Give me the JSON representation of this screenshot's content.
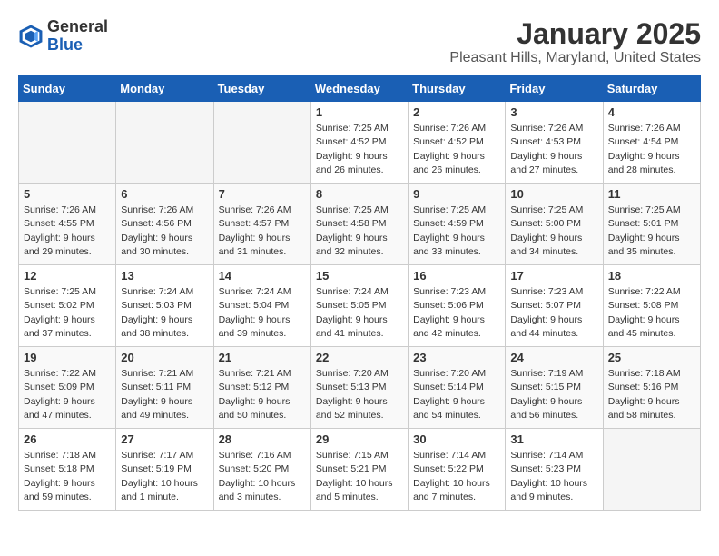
{
  "logo": {
    "general": "General",
    "blue": "Blue"
  },
  "header": {
    "month": "January 2025",
    "location": "Pleasant Hills, Maryland, United States"
  },
  "weekdays": [
    "Sunday",
    "Monday",
    "Tuesday",
    "Wednesday",
    "Thursday",
    "Friday",
    "Saturday"
  ],
  "weeks": [
    [
      {
        "day": "",
        "info": ""
      },
      {
        "day": "",
        "info": ""
      },
      {
        "day": "",
        "info": ""
      },
      {
        "day": "1",
        "info": "Sunrise: 7:25 AM\nSunset: 4:52 PM\nDaylight: 9 hours and 26 minutes."
      },
      {
        "day": "2",
        "info": "Sunrise: 7:26 AM\nSunset: 4:52 PM\nDaylight: 9 hours and 26 minutes."
      },
      {
        "day": "3",
        "info": "Sunrise: 7:26 AM\nSunset: 4:53 PM\nDaylight: 9 hours and 27 minutes."
      },
      {
        "day": "4",
        "info": "Sunrise: 7:26 AM\nSunset: 4:54 PM\nDaylight: 9 hours and 28 minutes."
      }
    ],
    [
      {
        "day": "5",
        "info": "Sunrise: 7:26 AM\nSunset: 4:55 PM\nDaylight: 9 hours and 29 minutes."
      },
      {
        "day": "6",
        "info": "Sunrise: 7:26 AM\nSunset: 4:56 PM\nDaylight: 9 hours and 30 minutes."
      },
      {
        "day": "7",
        "info": "Sunrise: 7:26 AM\nSunset: 4:57 PM\nDaylight: 9 hours and 31 minutes."
      },
      {
        "day": "8",
        "info": "Sunrise: 7:25 AM\nSunset: 4:58 PM\nDaylight: 9 hours and 32 minutes."
      },
      {
        "day": "9",
        "info": "Sunrise: 7:25 AM\nSunset: 4:59 PM\nDaylight: 9 hours and 33 minutes."
      },
      {
        "day": "10",
        "info": "Sunrise: 7:25 AM\nSunset: 5:00 PM\nDaylight: 9 hours and 34 minutes."
      },
      {
        "day": "11",
        "info": "Sunrise: 7:25 AM\nSunset: 5:01 PM\nDaylight: 9 hours and 35 minutes."
      }
    ],
    [
      {
        "day": "12",
        "info": "Sunrise: 7:25 AM\nSunset: 5:02 PM\nDaylight: 9 hours and 37 minutes."
      },
      {
        "day": "13",
        "info": "Sunrise: 7:24 AM\nSunset: 5:03 PM\nDaylight: 9 hours and 38 minutes."
      },
      {
        "day": "14",
        "info": "Sunrise: 7:24 AM\nSunset: 5:04 PM\nDaylight: 9 hours and 39 minutes."
      },
      {
        "day": "15",
        "info": "Sunrise: 7:24 AM\nSunset: 5:05 PM\nDaylight: 9 hours and 41 minutes."
      },
      {
        "day": "16",
        "info": "Sunrise: 7:23 AM\nSunset: 5:06 PM\nDaylight: 9 hours and 42 minutes."
      },
      {
        "day": "17",
        "info": "Sunrise: 7:23 AM\nSunset: 5:07 PM\nDaylight: 9 hours and 44 minutes."
      },
      {
        "day": "18",
        "info": "Sunrise: 7:22 AM\nSunset: 5:08 PM\nDaylight: 9 hours and 45 minutes."
      }
    ],
    [
      {
        "day": "19",
        "info": "Sunrise: 7:22 AM\nSunset: 5:09 PM\nDaylight: 9 hours and 47 minutes."
      },
      {
        "day": "20",
        "info": "Sunrise: 7:21 AM\nSunset: 5:11 PM\nDaylight: 9 hours and 49 minutes."
      },
      {
        "day": "21",
        "info": "Sunrise: 7:21 AM\nSunset: 5:12 PM\nDaylight: 9 hours and 50 minutes."
      },
      {
        "day": "22",
        "info": "Sunrise: 7:20 AM\nSunset: 5:13 PM\nDaylight: 9 hours and 52 minutes."
      },
      {
        "day": "23",
        "info": "Sunrise: 7:20 AM\nSunset: 5:14 PM\nDaylight: 9 hours and 54 minutes."
      },
      {
        "day": "24",
        "info": "Sunrise: 7:19 AM\nSunset: 5:15 PM\nDaylight: 9 hours and 56 minutes."
      },
      {
        "day": "25",
        "info": "Sunrise: 7:18 AM\nSunset: 5:16 PM\nDaylight: 9 hours and 58 minutes."
      }
    ],
    [
      {
        "day": "26",
        "info": "Sunrise: 7:18 AM\nSunset: 5:18 PM\nDaylight: 9 hours and 59 minutes."
      },
      {
        "day": "27",
        "info": "Sunrise: 7:17 AM\nSunset: 5:19 PM\nDaylight: 10 hours and 1 minute."
      },
      {
        "day": "28",
        "info": "Sunrise: 7:16 AM\nSunset: 5:20 PM\nDaylight: 10 hours and 3 minutes."
      },
      {
        "day": "29",
        "info": "Sunrise: 7:15 AM\nSunset: 5:21 PM\nDaylight: 10 hours and 5 minutes."
      },
      {
        "day": "30",
        "info": "Sunrise: 7:14 AM\nSunset: 5:22 PM\nDaylight: 10 hours and 7 minutes."
      },
      {
        "day": "31",
        "info": "Sunrise: 7:14 AM\nSunset: 5:23 PM\nDaylight: 10 hours and 9 minutes."
      },
      {
        "day": "",
        "info": ""
      }
    ]
  ]
}
